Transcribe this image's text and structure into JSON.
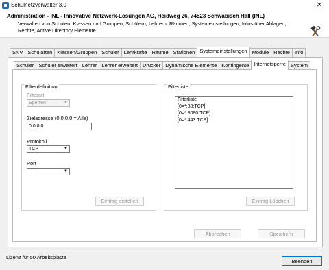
{
  "window": {
    "title": "Schulnetzverwalter 3.0",
    "close_glyph": "✕"
  },
  "header": {
    "title": "Administration - INL - Innovative Netzwerk-Lösungen AG, Heidweg 26, 74523 Schwäbisch Hall (INL)",
    "description": "Verwalten von Schulen, Klassen und Gruppen, Schülern, Lehrern, Räumen, Systemeinstellungen, Infos über Ablagen, Rechte, Active Directory Elemente..."
  },
  "main_tabs": [
    "SNV",
    "Schularten",
    "Klassen/Gruppen",
    "Schüler",
    "Lehrkräfte",
    "Räume",
    "Stationen",
    "Systemeinstellungen",
    "Module",
    "Rechte",
    "Info"
  ],
  "sub_tabs": [
    "Schüler",
    "Schüler erweitert",
    "Lehrer",
    "Lehrer erweitert",
    "Drucker",
    "Dynamische Elemente",
    "Kontingente",
    "Internetsperre",
    "System"
  ],
  "filter": {
    "group_title": "Filterdefinition",
    "filterart_label": "Filterart",
    "filterart_value": "Sperren",
    "zieladresse_label": "Zieladresse (0.0.0.0 = Alle)",
    "zieladresse_value": "0.0.0.0",
    "protokoll_label": "Protokoll",
    "protokoll_value": "TCP",
    "port_label": "Port",
    "port_value": "",
    "create_button": "Eintrag erstellen"
  },
  "filterlist": {
    "group_title": "Filterliste",
    "column_header": "Filterliste",
    "items": [
      "[0=*:80:TCP]",
      "[0=*:8080:TCP]",
      "[0=*:443:TCP]"
    ],
    "delete_button": "Eintrag Löschen"
  },
  "buttons": {
    "cancel": "Abbrechen",
    "save": "Speichern",
    "close": "Beenden"
  },
  "status": {
    "license": "Lizenz für 50 Arbeitsplätze"
  }
}
